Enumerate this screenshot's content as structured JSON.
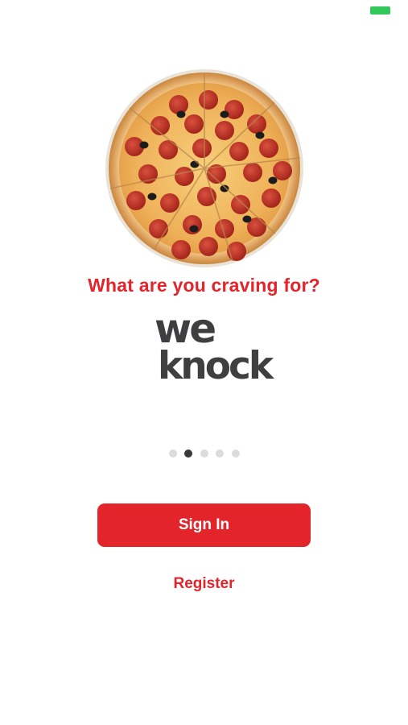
{
  "status_bar": {
    "battery_color": "#34c759"
  },
  "hero": {
    "image": "pepperoni-pizza"
  },
  "tagline": "What are you craving for?",
  "logo": {
    "line1": "we",
    "line2": "knock",
    "color": "#3f3f41"
  },
  "pager": {
    "count": 5,
    "active_index": 1
  },
  "actions": {
    "sign_in": "Sign In",
    "register": "Register"
  },
  "colors": {
    "accent": "#e3242b",
    "dot_inactive": "#dcdcdc",
    "dot_active": "#3a3a3a"
  }
}
